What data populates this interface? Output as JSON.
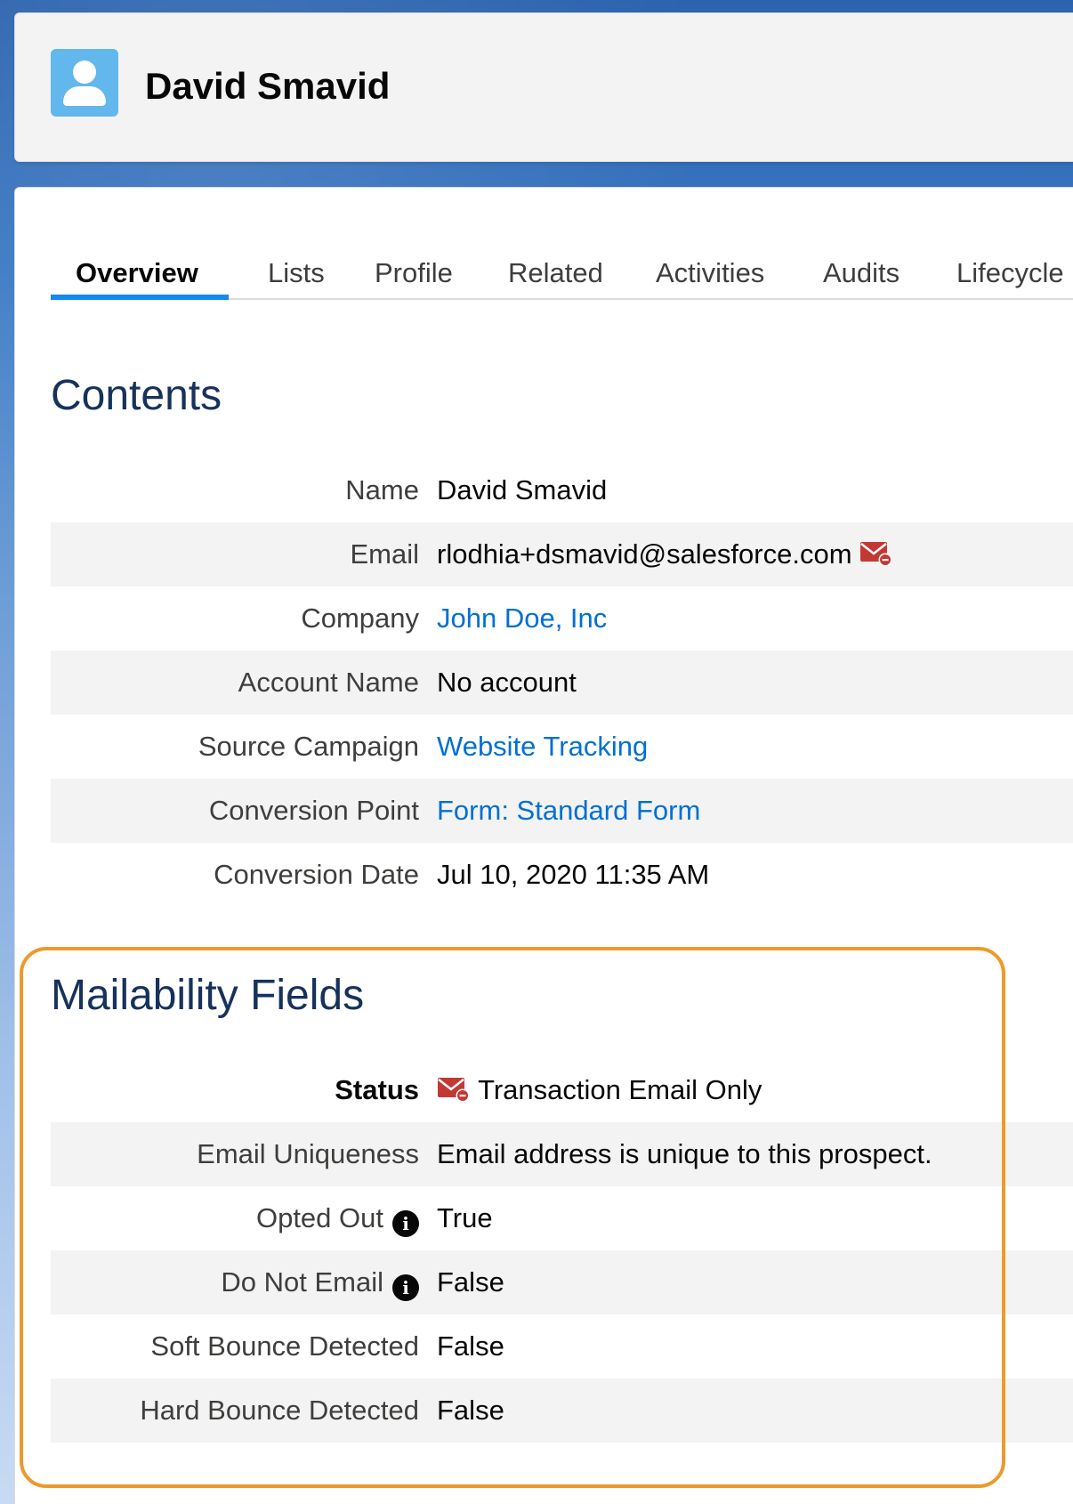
{
  "header": {
    "name": "David Smavid",
    "avatar_icon": "user-icon",
    "avatar_color": "#62b7ed"
  },
  "tabs": [
    {
      "label": "Overview",
      "active": true
    },
    {
      "label": "Lists"
    },
    {
      "label": "Profile"
    },
    {
      "label": "Related"
    },
    {
      "label": "Activities"
    },
    {
      "label": "Audits"
    },
    {
      "label": "Lifecycle"
    }
  ],
  "contents": {
    "title": "Contents",
    "rows": [
      {
        "label": "Name",
        "value": "David Smavid"
      },
      {
        "label": "Email",
        "value": "rlodhia+dsmavid@salesforce.com",
        "icon": "mail-blocked-icon"
      },
      {
        "label": "Company",
        "value": "John Doe, Inc",
        "link": true
      },
      {
        "label": "Account Name",
        "value": "No account"
      },
      {
        "label": "Source Campaign",
        "value": "Website Tracking",
        "link": true
      },
      {
        "label": "Conversion Point",
        "value": "Form: Standard Form",
        "link": true
      },
      {
        "label": "Conversion Date",
        "value": "Jul 10, 2020 11:35 AM"
      }
    ]
  },
  "mailability": {
    "title": "Mailability Fields",
    "rows": [
      {
        "label": "Status",
        "value": "Transaction Email Only",
        "icon": "mail-blocked-icon"
      },
      {
        "label": "Email Uniqueness",
        "value": "Email address is unique to this prospect."
      },
      {
        "label": "Opted Out",
        "value": "True",
        "info": true
      },
      {
        "label": "Do Not Email",
        "value": "False",
        "info": true
      },
      {
        "label": "Soft Bounce Detected",
        "value": "False"
      },
      {
        "label": "Hard Bounce Detected",
        "value": "False"
      }
    ]
  },
  "colors": {
    "link": "#0070d2",
    "tab_active_underline": "#1589ee",
    "section_title": "#16325c",
    "highlight_border": "#ec9a2b",
    "mail_icon": "#c23934"
  }
}
